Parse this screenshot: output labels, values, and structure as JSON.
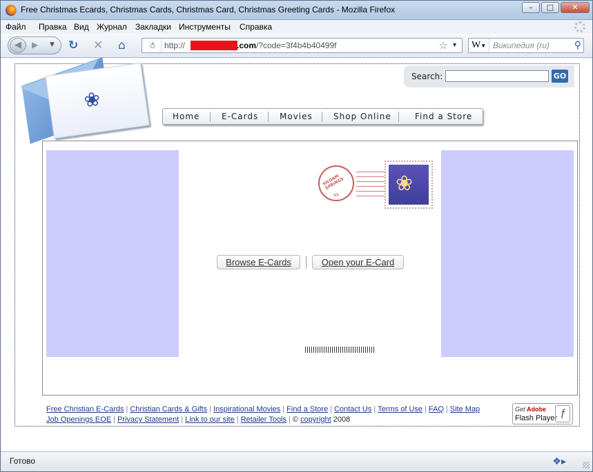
{
  "window": {
    "title": "Free Christmas Ecards, Christmas Cards, Christmas Card, Christmas Greeting Cards - Mozilla Firefox",
    "controls": [
      "–",
      "□",
      "✕"
    ]
  },
  "menu": [
    "Файл",
    "Правка",
    "Вид",
    "Журнал",
    "Закладки",
    "Инструменты",
    "Справка"
  ],
  "toolbar": {
    "url_prefix": "http://",
    "url_domain_suffix": ".com",
    "url_path": "/?code=3f4b4b40499f",
    "search_engine": "W",
    "search_placeholder": "Википедия (ru)"
  },
  "site": {
    "search_label": "Search:",
    "search_button": "GO",
    "nav": [
      "Home",
      "E-Cards",
      "Movies",
      "Shop Online",
      "Find a Store"
    ],
    "postmark_text": "SILOAM SPRINGS",
    "postmark_state": "AR",
    "browse_button": "Browse E-Cards",
    "open_button": "Open your E-Card",
    "footer_row1": [
      "Free Christian E-Cards",
      "Christian Cards & Gifts",
      "Inspirational Movies",
      "Find a Store",
      "Contact Us",
      "Terms of Use",
      "FAQ",
      "Site Map"
    ],
    "footer_row2": [
      "Job Openings EOE",
      "Privacy Statement",
      "Link to our site",
      "Retailer Tools"
    ],
    "copyright_symbol": "©",
    "copyright_link": "copyright",
    "copyright_year": "2008",
    "flash_get": "Get",
    "flash_adobe": "Adobe",
    "flash_player": "Flash",
    "flash_player_word": "Player"
  },
  "status": {
    "text": "Готово"
  },
  "colors": {
    "side_panel": "#ccccff",
    "go_button": "#2f6bb1",
    "link": "#1c3a8a"
  }
}
